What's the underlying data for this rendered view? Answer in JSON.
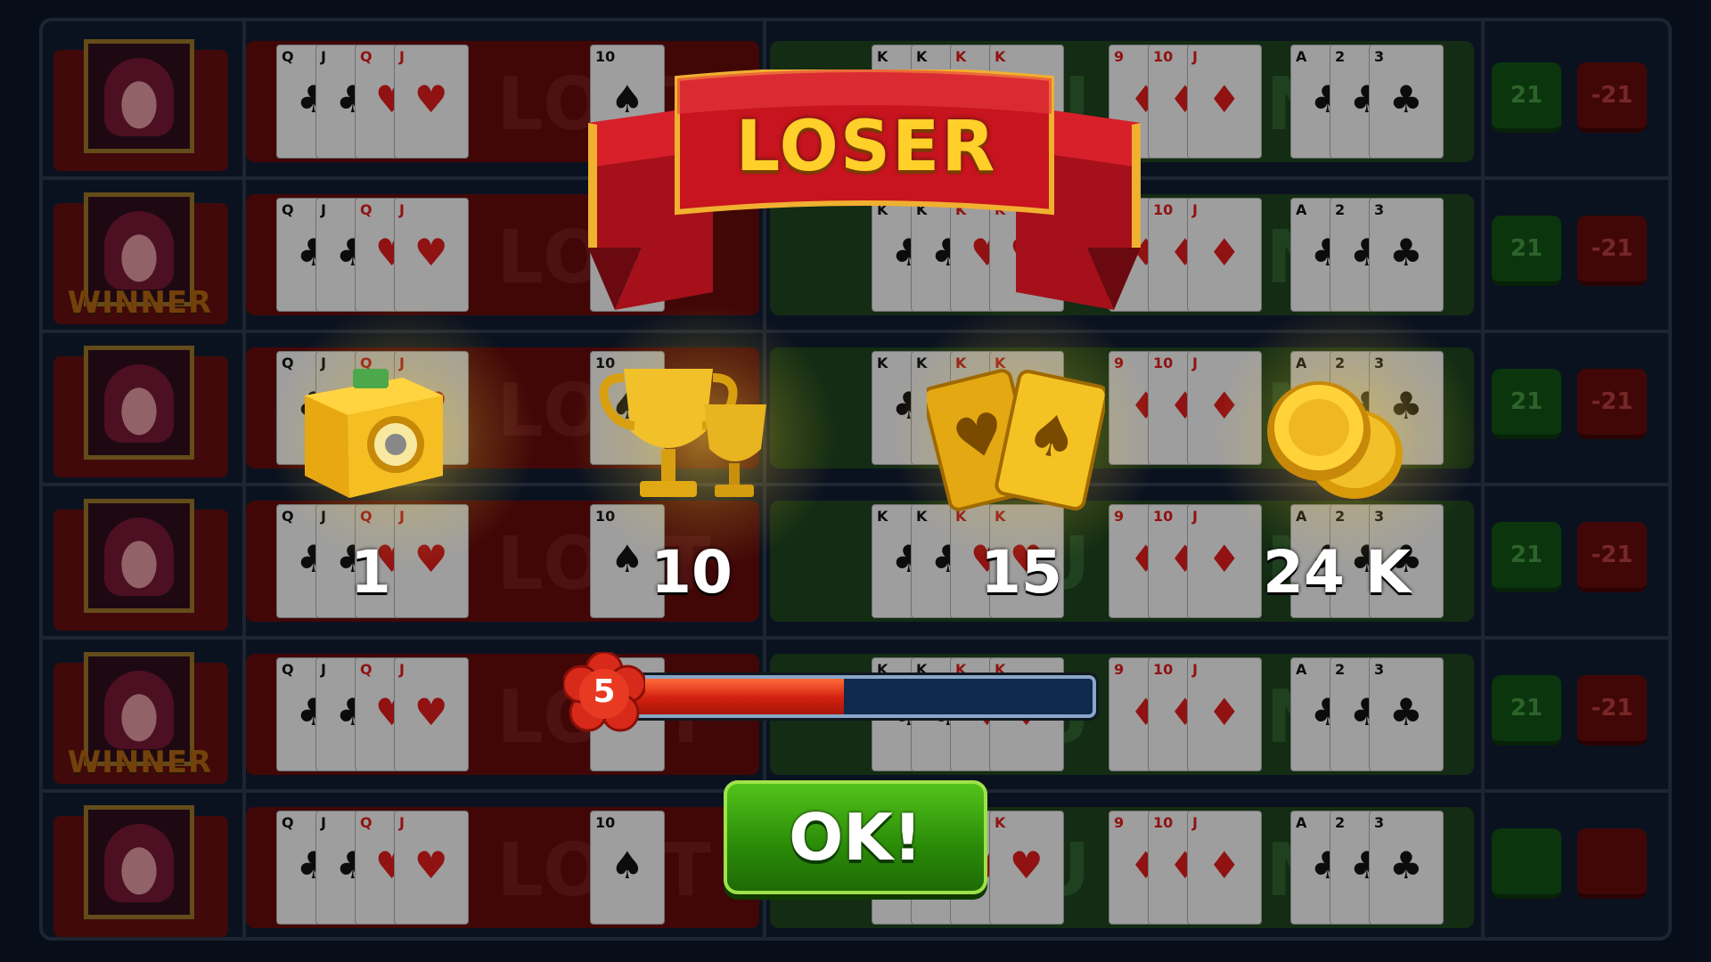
{
  "board": {
    "rows": [
      {
        "winner": false,
        "lost_text": "YOU LOST",
        "won_text": "YOU WON",
        "score_pos": "21",
        "score_neg": "-21"
      },
      {
        "winner": true,
        "lost_text": "YOU LOST",
        "won_text": "YOU WON",
        "score_pos": "21",
        "score_neg": "-21"
      },
      {
        "winner": false,
        "lost_text": "YOU LOST",
        "won_text": "YOU WON",
        "score_pos": "21",
        "score_neg": "-21"
      },
      {
        "winner": false,
        "lost_text": "YOU LOST",
        "won_text": "YOU WON",
        "score_pos": "21",
        "score_neg": "-21"
      },
      {
        "winner": true,
        "lost_text": "YOU LOST",
        "won_text": "YOU WON",
        "score_pos": "21",
        "score_neg": "-21"
      },
      {
        "winner": false,
        "lost_text": "YOU LOST",
        "won_text": "YOU WON",
        "score_pos": "",
        "score_neg": ""
      }
    ],
    "winner_label": "WINNER",
    "cards": [
      {
        "rank": "Q",
        "suit": "♣",
        "red": false
      },
      {
        "rank": "J",
        "suit": "♣",
        "red": false
      },
      {
        "rank": "Q",
        "suit": "♥",
        "red": true
      },
      {
        "rank": "J",
        "suit": "♥",
        "red": true
      },
      {
        "rank": "10",
        "suit": "♠",
        "red": false
      },
      {
        "rank": "K",
        "suit": "♣",
        "red": false
      },
      {
        "rank": "K",
        "suit": "♥",
        "red": true
      },
      {
        "rank": "9",
        "suit": "♦",
        "red": true
      },
      {
        "rank": "10",
        "suit": "♦",
        "red": true
      },
      {
        "rank": "J",
        "suit": "♦",
        "red": true
      },
      {
        "rank": "A",
        "suit": "♣",
        "red": false
      },
      {
        "rank": "2",
        "suit": "♣",
        "red": false
      },
      {
        "rank": "3",
        "suit": "♣",
        "red": false
      }
    ]
  },
  "result": {
    "title": "LOSER",
    "rewards": [
      {
        "icon": "vault-icon",
        "value": "1"
      },
      {
        "icon": "trophy-icon",
        "value": "10"
      },
      {
        "icon": "cards-icon",
        "value": "15"
      },
      {
        "icon": "coins-icon",
        "value": "24 K"
      }
    ],
    "level": "5",
    "level_progress": 0.46,
    "ok_label": "OK!"
  },
  "colors": {
    "lost_panel": "#5a0a0a",
    "won_panel": "#1b3d1b",
    "gold": "#ffcf2a",
    "ok_green": "#2a8a08"
  }
}
